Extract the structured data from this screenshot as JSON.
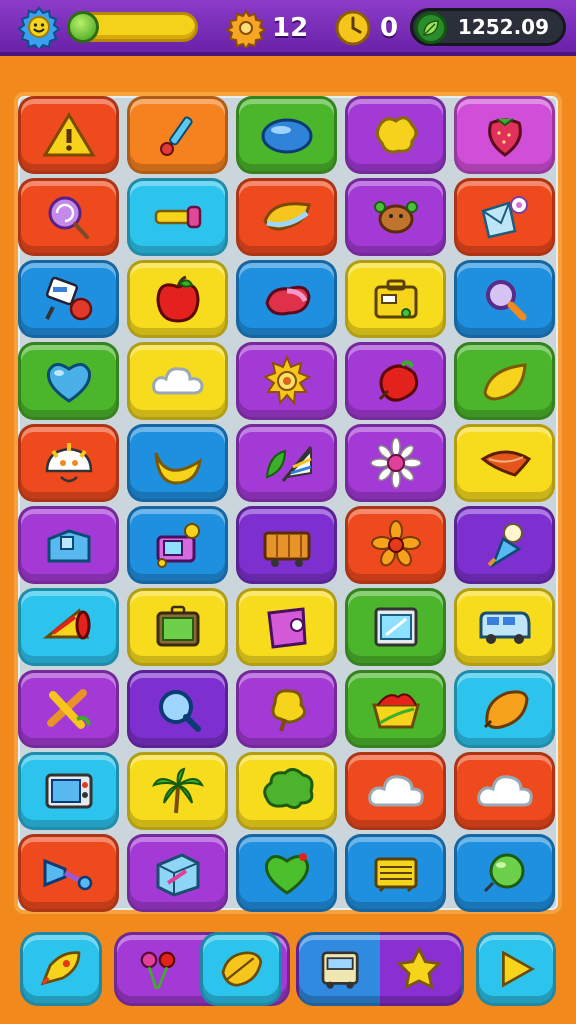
{
  "hud": {
    "gears_count": "12",
    "clock_count": "0",
    "score": "1252.09"
  },
  "colors": {
    "top_bar": "#7a2dbc",
    "background": "#f2891c",
    "board": "#cbd5dc"
  },
  "board": {
    "rows": 10,
    "cols": 5,
    "tiles": [
      [
        "warning-sign",
        "paintbrush",
        "blue-gem",
        "yellow-blob",
        "strawberry-fruit"
      ],
      [
        "lollipop",
        "flashlight",
        "wing-gem",
        "crab-creature",
        "envelope-flower"
      ],
      [
        "cannon-tool",
        "red-apple",
        "red-candy",
        "suitcase",
        "magnifier"
      ],
      [
        "blue-heart",
        "cloud",
        "sun",
        "red-fruit",
        "yellow-leaf"
      ],
      [
        "sunny-face",
        "banana",
        "flag-leaf",
        "daisy",
        "orange-slice"
      ],
      [
        "blue-box",
        "robot-camera",
        "delivery-truck",
        "orange-flower",
        "ice-cream"
      ],
      [
        "megaphone",
        "tablet",
        "purple-jar",
        "monitor",
        "camper-van"
      ],
      [
        "pretzel-knot",
        "blue-magnifier",
        "yellow-tree",
        "salad-bowl",
        "orange-lemon"
      ],
      [
        "tv-screen",
        "palm-tree",
        "green-bush",
        "white-cloud",
        "cloud-pair"
      ],
      [
        "trumpet",
        "gift-box",
        "green-heart",
        "yellow-radiator",
        "green-ball"
      ]
    ]
  },
  "bottom_buttons": [
    "rocket",
    "cherries",
    "leaf-badge",
    "bus",
    "star",
    "play-arrow"
  ]
}
